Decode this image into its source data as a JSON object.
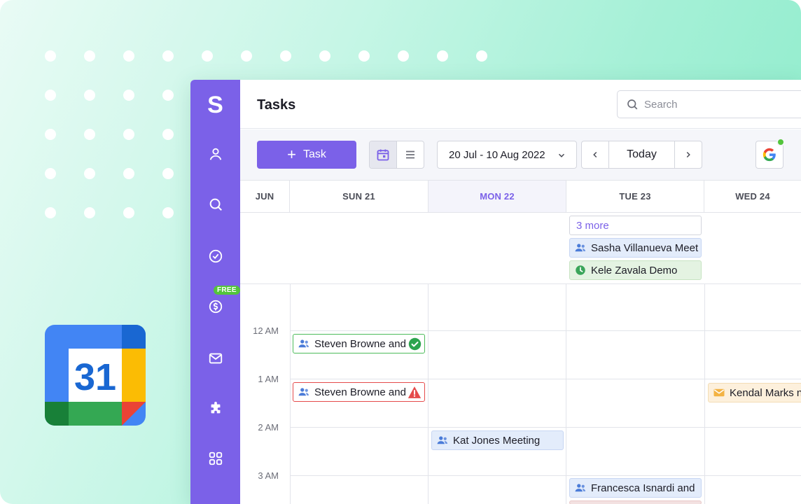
{
  "app": {
    "logo_letter": "S",
    "free_badge": "FREE",
    "rail": [
      "user-icon",
      "search-icon",
      "check-circle-icon",
      "dollar-icon",
      "mail-icon",
      "puzzle-icon",
      "apps-grid-icon"
    ]
  },
  "header": {
    "title": "Tasks",
    "search_placeholder": "Search"
  },
  "toolbar": {
    "task_button": "Task",
    "date_range": "20 Jul - 10 Aug 2022",
    "today_button": "Today"
  },
  "badge": {
    "logo_number": "31"
  },
  "calendar": {
    "days": [
      {
        "label": "JUN",
        "today": false
      },
      {
        "label": "SUN 21",
        "today": false
      },
      {
        "label": "MON 22",
        "today": true
      },
      {
        "label": "TUE 23",
        "today": false
      },
      {
        "label": "WED 24",
        "today": false
      }
    ],
    "times": [
      "12 AM",
      "1 AM",
      "2 AM",
      "3 AM"
    ],
    "allday_events": {
      "more": "3 more",
      "sasha": "Sasha Villanueva Meet",
      "kele": "Kele Zavala Demo"
    },
    "events": {
      "steven1": "Steven Browne and",
      "steven2": "Steven Browne and",
      "kendal": "Kendal Marks n",
      "kat": "Kat Jones Meeting",
      "francesca": "Francesca Isnardi and"
    }
  },
  "colors": {
    "accent": "#7b61e8",
    "success": "#4cbb5a",
    "error": "#e54b4b",
    "badge_green": "#53c43b"
  }
}
